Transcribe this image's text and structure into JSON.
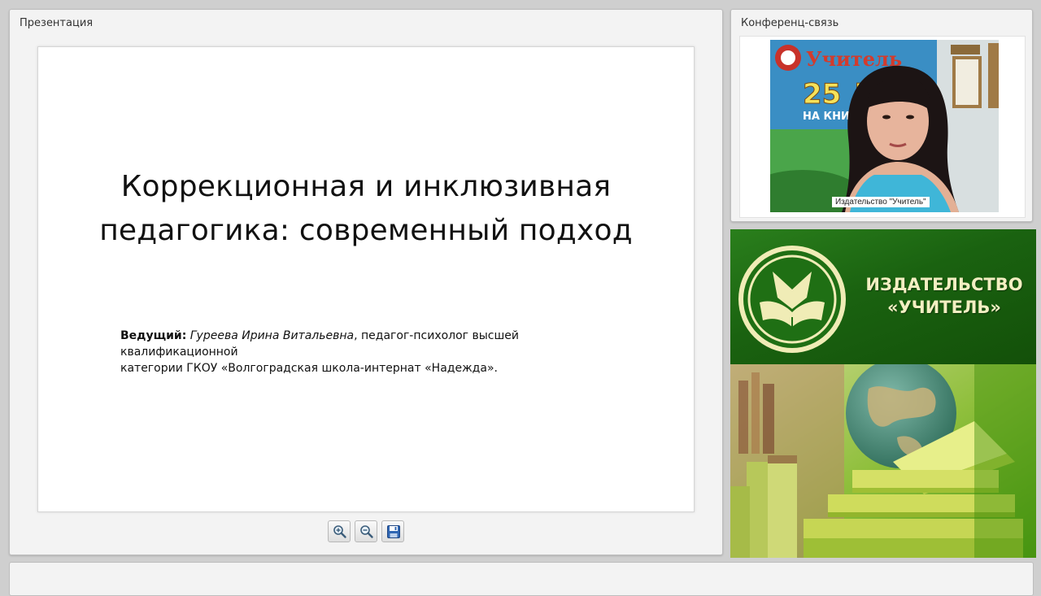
{
  "presentation": {
    "title": "Презентация",
    "slide": {
      "title_line1": "Коррекционная и инклюзивная",
      "title_line2": "педагогика: современный подход",
      "presenter_label": "Ведущий:",
      "presenter_name": "Гуреева Ирина Витальевна",
      "presenter_desc_1": ", педагог-психолог высшей квалификационной",
      "presenter_desc_2": "категории ГКОУ «Волгоградская школа-интернат «Надежда»."
    },
    "toolbar": {
      "zoom_in_icon": "zoom-in-icon",
      "zoom_out_icon": "zoom-out-icon",
      "save_icon": "save-icon"
    }
  },
  "conference": {
    "title": "Конференц-связь",
    "video_caption": "Издательство \"Учитель\"",
    "poster_brand": "Учитель",
    "poster_years": "25 ЛЕТ",
    "poster_sub": "НА КНИЖНОМ"
  },
  "ad": {
    "line1": "ИЗДАТЕЛЬСТВО",
    "line2": "«УЧИТЕЛЬ»",
    "colors": {
      "green": "#1a6210",
      "cream": "#f3efc2"
    }
  }
}
